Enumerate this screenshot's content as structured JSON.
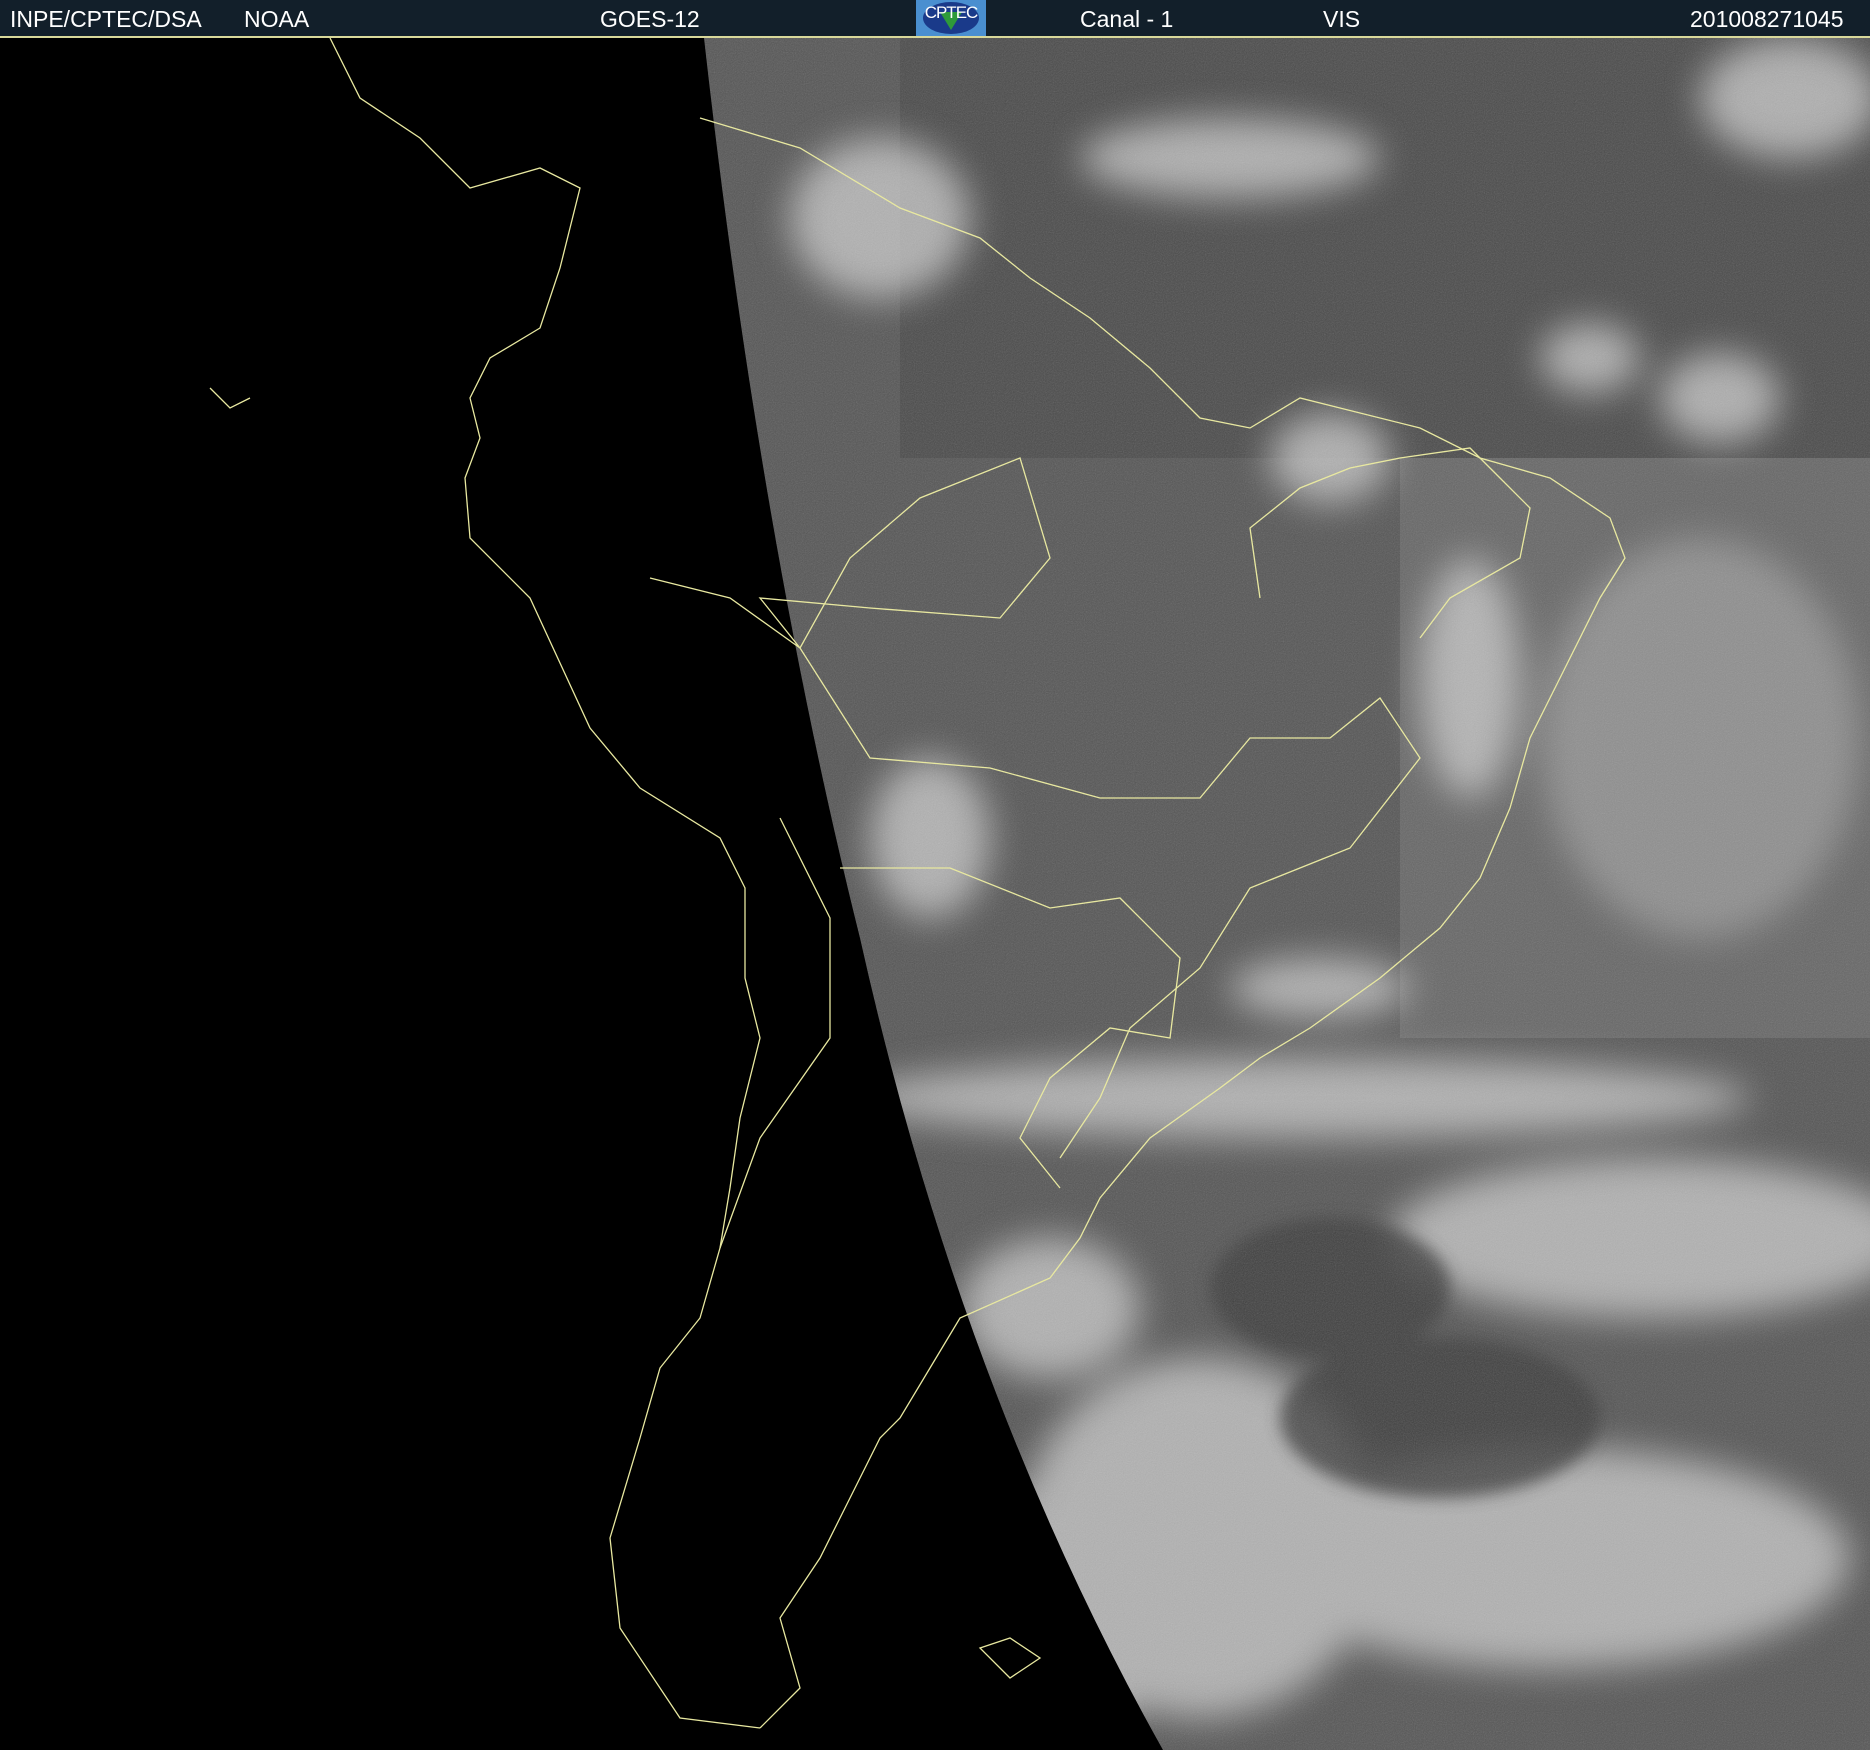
{
  "header": {
    "institution": "INPE/CPTEC/DSA",
    "agency": "NOAA",
    "satellite": "GOES-12",
    "logo_text": "CPTEC",
    "channel": "Canal - 1",
    "band": "VIS",
    "timestamp": "201008271045"
  },
  "colors": {
    "header_bg": "#121f2a",
    "coastline": "#e8e8a0",
    "space": "#000000"
  }
}
